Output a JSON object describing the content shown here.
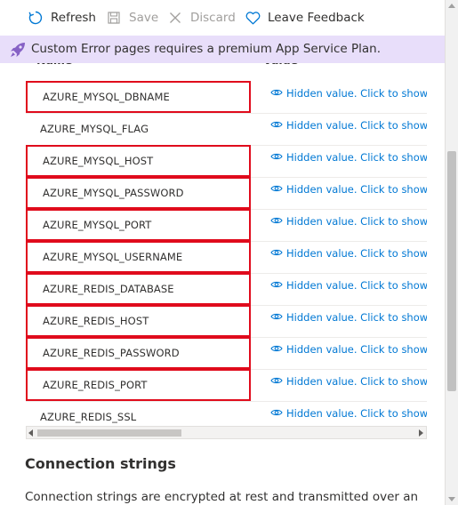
{
  "toolbar": {
    "refresh_label": "Refresh",
    "save_label": "Save",
    "discard_label": "Discard",
    "feedback_label": "Leave Feedback",
    "accent_color": "#0078d4",
    "disabled_color": "#a19f9d"
  },
  "banner": {
    "text": "Custom Error pages requires a premium App Service Plan.",
    "icon": "rocket-icon",
    "background": "#e8defa"
  },
  "table": {
    "columns": [
      "Name",
      "Value"
    ],
    "rows": [
      {
        "name": "AZURE_MYSQL_DBNAME",
        "value": "Hidden value. Click to show value",
        "highlighted": true
      },
      {
        "name": "AZURE_MYSQL_FLAG",
        "value": "Hidden value. Click to show value",
        "highlighted": false
      },
      {
        "name": "AZURE_MYSQL_HOST",
        "value": "Hidden value. Click to show value",
        "highlighted": true
      },
      {
        "name": "AZURE_MYSQL_PASSWORD",
        "value": "Hidden value. Click to show value",
        "highlighted": true
      },
      {
        "name": "AZURE_MYSQL_PORT",
        "value": "Hidden value. Click to show value",
        "highlighted": true
      },
      {
        "name": "AZURE_MYSQL_USERNAME",
        "value": "Hidden value. Click to show value",
        "highlighted": true
      },
      {
        "name": "AZURE_REDIS_DATABASE",
        "value": "Hidden value. Click to show value",
        "highlighted": true
      },
      {
        "name": "AZURE_REDIS_HOST",
        "value": "Hidden value. Click to show value",
        "highlighted": true
      },
      {
        "name": "AZURE_REDIS_PASSWORD",
        "value": "Hidden value. Click to show value",
        "highlighted": true
      },
      {
        "name": "AZURE_REDIS_PORT",
        "value": "Hidden value. Click to show value",
        "highlighted": true
      },
      {
        "name": "AZURE_REDIS_SSL",
        "value": "Hidden value. Click to show value",
        "highlighted": false
      }
    ],
    "highlight_color": "#e00b1c",
    "value_icon": "eye-icon"
  },
  "connection_strings": {
    "title": "Connection strings",
    "description": "Connection strings are encrypted at rest and transmitted over an"
  }
}
